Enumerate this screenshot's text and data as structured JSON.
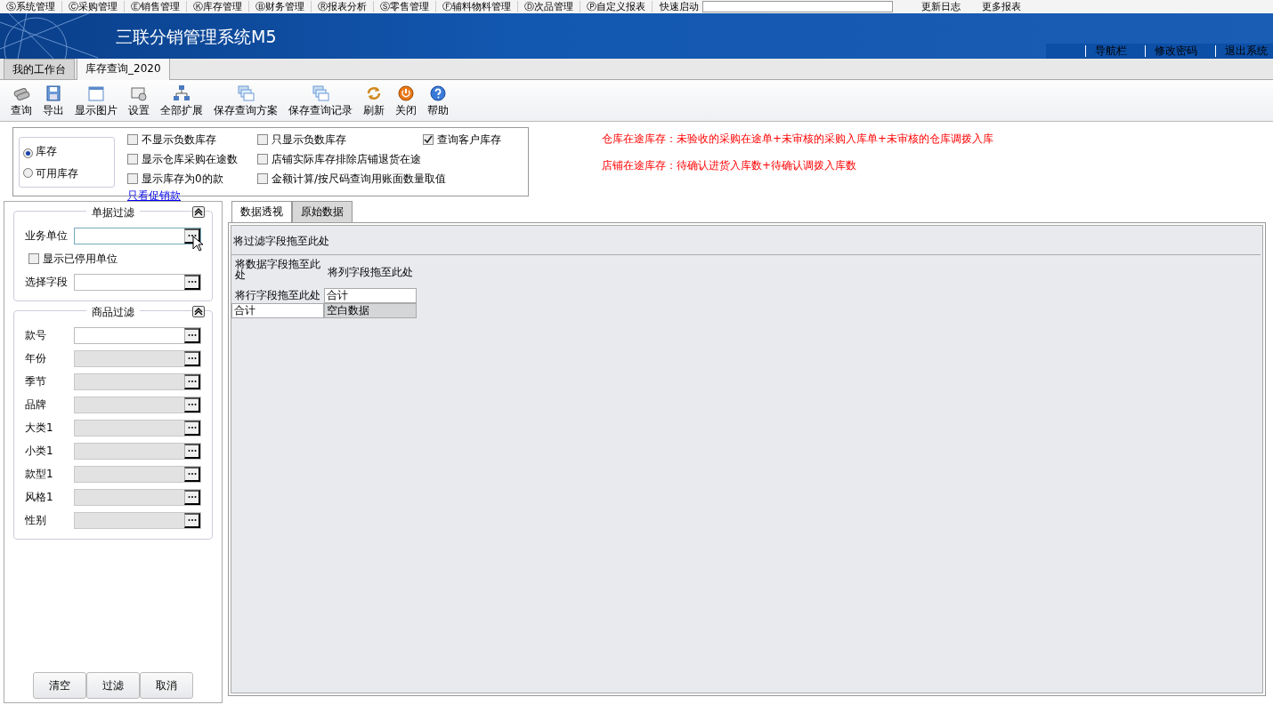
{
  "menu_bar": {
    "items": [
      "Ⓢ系统管理",
      "Ⓒ采购管理",
      "Ⓔ销售管理",
      "Ⓚ库存管理",
      "Ⓑ财务管理",
      "Ⓡ报表分析",
      "Ⓢ零售管理",
      "Ⓕ辅料物料管理",
      "Ⓓ次品管理",
      "Ⓟ自定义报表"
    ],
    "quick_launch": "快速启动",
    "links": [
      "更新日志",
      "更多报表"
    ]
  },
  "header": {
    "title": "三联分销管理系统M5",
    "links": [
      "导航栏",
      "修改密码",
      "退出系统"
    ]
  },
  "tabs": [
    {
      "label": "我的工作台",
      "selected": false
    },
    {
      "label": "库存查询_2020",
      "selected": true
    }
  ],
  "toolbar": [
    {
      "label": "查询",
      "kind": "query"
    },
    {
      "label": "导出",
      "kind": "save"
    },
    {
      "label": "显示图片",
      "kind": "window"
    },
    {
      "label": "设置",
      "kind": "settings"
    },
    {
      "label": "全部扩展",
      "kind": "tree"
    },
    {
      "label": "保存查询方案",
      "kind": "stack"
    },
    {
      "label": "保存查询记录",
      "kind": "stack"
    },
    {
      "label": "刷新",
      "kind": "refresh"
    },
    {
      "label": "关闭",
      "kind": "close"
    },
    {
      "label": "帮助",
      "kind": "help"
    }
  ],
  "stock_type": [
    {
      "label": "库存",
      "selected": true
    },
    {
      "label": "可用库存",
      "selected": false
    }
  ],
  "option_columns": [
    [
      {
        "label": "不显示负数库存",
        "checked": false
      },
      {
        "label": "显示仓库采购在途数",
        "checked": false
      },
      {
        "label": "显示库存为0的款",
        "checked": false
      }
    ],
    [
      {
        "label": "只显示负数库存",
        "checked": false
      },
      {
        "label": "店铺实际库存排除店铺退货在途",
        "checked": false
      },
      {
        "label": "金额计算/按尺码查询用账面数量取值",
        "checked": false
      }
    ],
    [
      {
        "label": "查询客户库存",
        "checked": true
      }
    ]
  ],
  "promo_link": "只看促销款",
  "notes": [
    "仓库在途库存：未验收的采购在途单+未审核的采购入库单+未审核的仓库调拨入库",
    "店铺在途库存：待确认进货入库数+待确认调拨入库数"
  ],
  "document_filter": {
    "title": "单据过滤",
    "rows": [
      {
        "kind": "field",
        "label": "业务单位"
      },
      {
        "kind": "checkbox",
        "label": "显示已停用单位",
        "checked": false
      },
      {
        "kind": "field",
        "label": "选择字段"
      }
    ]
  },
  "product_filter": {
    "title": "商品过滤",
    "rows": [
      {
        "label": "款号",
        "disabled": false
      },
      {
        "label": "年份",
        "disabled": true
      },
      {
        "label": "季节",
        "disabled": true
      },
      {
        "label": "品牌",
        "disabled": true
      },
      {
        "label": "大类1",
        "disabled": true
      },
      {
        "label": "小类1",
        "disabled": true
      },
      {
        "label": "款型1",
        "disabled": true
      },
      {
        "label": "风格1",
        "disabled": true
      },
      {
        "label": "性别",
        "disabled": true
      }
    ]
  },
  "filter_buttons": [
    "清空",
    "过滤",
    "取消"
  ],
  "result_tabs": [
    {
      "label": "数据透视",
      "selected": true
    },
    {
      "label": "原始数据",
      "selected": false
    }
  ],
  "pivot": {
    "filter_area": "将过滤字段拖至此处",
    "data_area": "将数据字段拖至此处",
    "column_area": "将列字段拖至此处",
    "row_area": "将行字段拖至此处",
    "column_total": "合计",
    "row_total": "合计",
    "cell": "空白数据"
  }
}
